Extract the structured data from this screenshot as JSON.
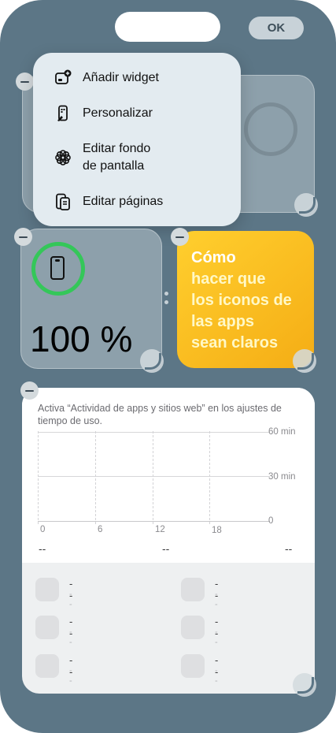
{
  "header": {
    "ok_label": "OK"
  },
  "menu": {
    "items": [
      {
        "label": "Añadir widget",
        "icon": "add-widget-icon"
      },
      {
        "label": "Personalizar",
        "icon": "customize-icon"
      },
      {
        "label": "Editar fondo\nde pantalla",
        "icon": "wallpaper-flower-icon"
      },
      {
        "label": "Editar páginas",
        "icon": "edit-pages-icon"
      }
    ]
  },
  "battery": {
    "percent_text": "100 %",
    "level": 100,
    "ring_color": "#34c759"
  },
  "tip": {
    "lines": [
      "Cómo",
      "hacer que",
      "los iconos de",
      "las apps",
      "sean claros"
    ],
    "color": "#f5ad15"
  },
  "screentime": {
    "note": "Activa “Actividad de apps y sitios web” en los ajustes de tiempo de uso.",
    "y_ticks": [
      "60 min",
      "30 min",
      "0"
    ],
    "x_ticks": [
      "0",
      "6",
      "12",
      "18"
    ],
    "summary": [
      "--",
      "--",
      "--"
    ],
    "apps": [
      {
        "name": "--",
        "time": "--"
      },
      {
        "name": "--",
        "time": "--"
      },
      {
        "name": "--",
        "time": "--"
      },
      {
        "name": "--",
        "time": "--"
      },
      {
        "name": "--",
        "time": "--"
      },
      {
        "name": "--",
        "time": "--"
      }
    ]
  }
}
